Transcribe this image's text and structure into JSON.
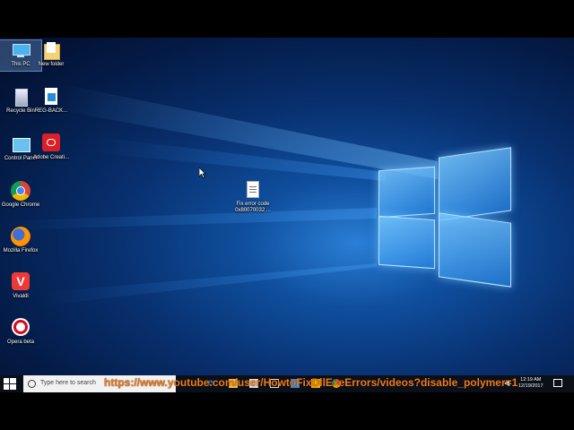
{
  "desktop": {
    "icons": [
      {
        "label": "This PC",
        "icon": "this-pc-icon"
      },
      {
        "label": "New folder",
        "icon": "folder-icon"
      },
      {
        "label": "Recycle Bin",
        "icon": "recycle-bin-icon"
      },
      {
        "label": "REG-BACK...",
        "icon": "reg-file-icon"
      },
      {
        "label": "Control Panel",
        "icon": "control-panel-icon"
      },
      {
        "label": "Adobe Creati...",
        "icon": "adobe-creative-cloud-icon"
      },
      {
        "label": "Google Chrome",
        "icon": "chrome-icon"
      },
      {
        "label": "Mozilla Firefox",
        "icon": "firefox-icon"
      },
      {
        "label": "Vivaldi",
        "icon": "vivaldi-icon"
      },
      {
        "label": "Opera beta",
        "icon": "opera-icon"
      },
      {
        "label_line1": "Fix error code",
        "label_line2": "0x80070032 ...",
        "icon": "text-file-icon"
      }
    ]
  },
  "taskbar": {
    "search_placeholder": "Type here to search",
    "clock_time": "12:19 AM",
    "clock_date": "12/19/2017"
  },
  "overlay": {
    "url_text": "https://www.youtube.com/user/HowtoFixDllExeErrors/videos?disable_polymer=1"
  },
  "colors": {
    "taskbar_bg": "#0b0f18",
    "url_text": "#f07b1a",
    "desktop_accent": "#2a7fd6"
  }
}
